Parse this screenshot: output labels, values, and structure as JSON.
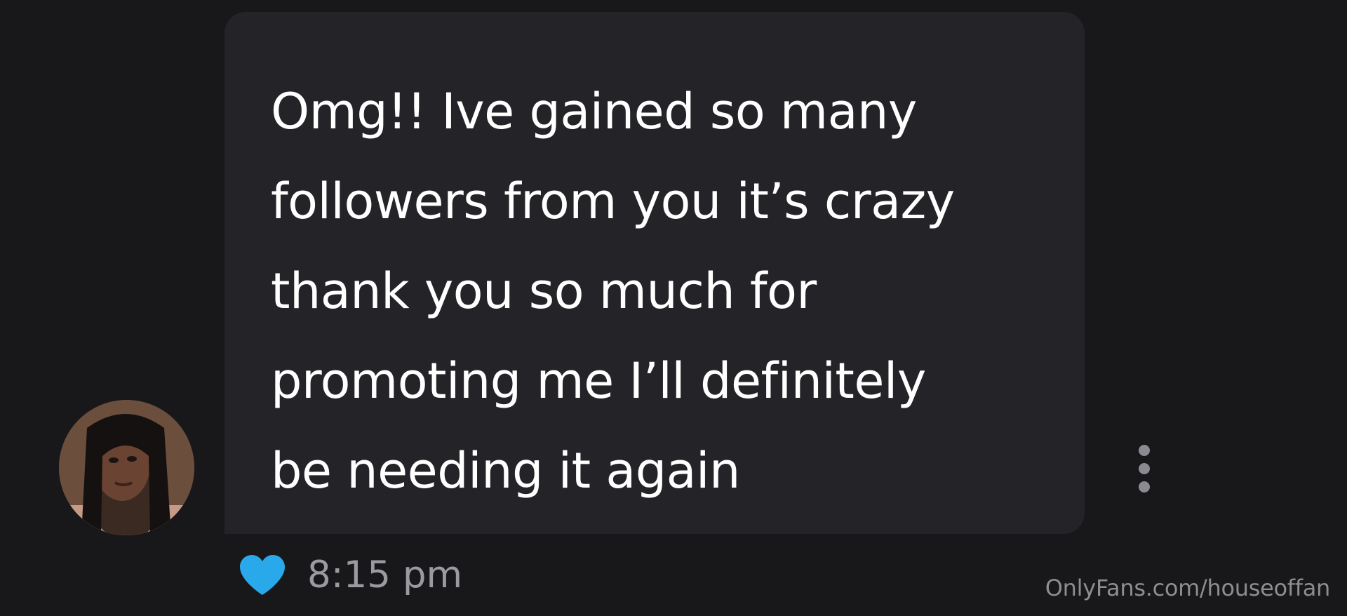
{
  "message": {
    "text": "Omg!! Ive gained so many\nfollowers from you it’s crazy\nthank you so much for\npromoting me I’ll definitely\nbe needing it again",
    "time": "8:15 pm",
    "liked": true
  },
  "icons": {
    "like": "heart-icon",
    "more": "more-vertical-icon"
  },
  "watermark": "OnlyFans.com/houseoffan",
  "colors": {
    "background": "#18181a",
    "bubble": "#242428",
    "message_text": "#ffffff",
    "like_heart": "#29a9ea",
    "timestamp": "#9a9aa0"
  }
}
